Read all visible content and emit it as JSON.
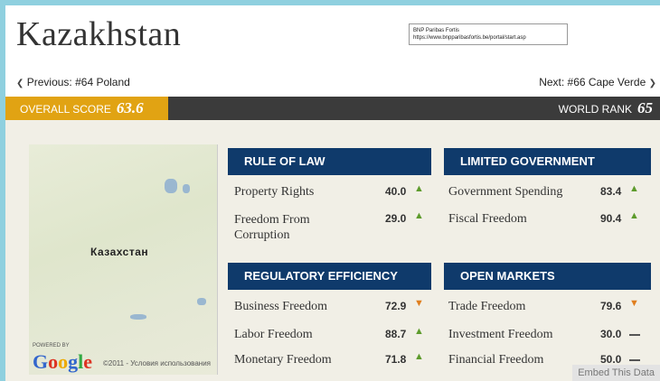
{
  "title": "Kazakhstan",
  "tooltip": {
    "line1": "BNP Paribas Fortis",
    "line2": "https://www.bnpparibasfortis.be/portal/start.asp"
  },
  "nav": {
    "prev": "Previous: #64 Poland",
    "next": "Next: #66 Cape Verde"
  },
  "overall": {
    "label": "OVERALL SCORE",
    "value": "63.6"
  },
  "rank": {
    "label": "WORLD RANK",
    "value": "65"
  },
  "map": {
    "label": "Казахстан",
    "powered": "POWERED BY",
    "google_letters": [
      "G",
      "o",
      "o",
      "g",
      "l",
      "e"
    ],
    "terms": "©2011 - Условия использования"
  },
  "panels": {
    "rule_of_law": {
      "title": "RULE OF LAW",
      "items": [
        {
          "name": "Property Rights",
          "value": "40.0",
          "trend": "up"
        },
        {
          "name": "Freedom From Corruption",
          "value": "29.0",
          "trend": "up"
        }
      ]
    },
    "limited_gov": {
      "title": "LIMITED GOVERNMENT",
      "items": [
        {
          "name": "Government Spending",
          "value": "83.4",
          "trend": "up"
        },
        {
          "name": "Fiscal Freedom",
          "value": "90.4",
          "trend": "up"
        }
      ]
    },
    "regulatory": {
      "title": "REGULATORY EFFICIENCY",
      "items": [
        {
          "name": "Business Freedom",
          "value": "72.9",
          "trend": "down"
        },
        {
          "name": "Labor Freedom",
          "value": "88.7",
          "trend": "up"
        },
        {
          "name": "Monetary Freedom",
          "value": "71.8",
          "trend": "up"
        }
      ]
    },
    "open_markets": {
      "title": "OPEN MARKETS",
      "items": [
        {
          "name": "Trade Freedom",
          "value": "79.6",
          "trend": "down"
        },
        {
          "name": "Investment Freedom",
          "value": "30.0",
          "trend": "flat"
        },
        {
          "name": "Financial Freedom",
          "value": "50.0",
          "trend": "flat"
        }
      ]
    }
  },
  "embed": "Embed This Data",
  "colors": {
    "score_bg": "#e1a313",
    "panel_header": "#0f3a6b",
    "trend_up": "#5d9b2c",
    "trend_down": "#e07e1e"
  }
}
